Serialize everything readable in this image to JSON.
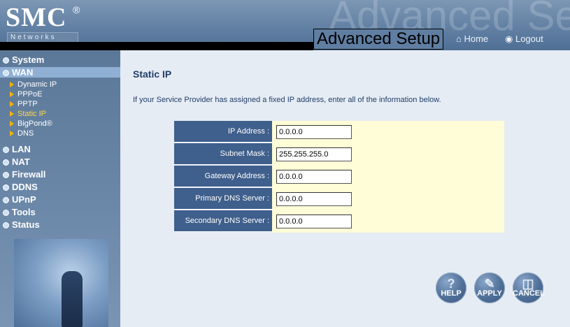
{
  "header": {
    "logo": "SMC",
    "logo_reg": "®",
    "networks": "Networks",
    "watermark": "Advanced Setup",
    "title": "Advanced Setup",
    "home": "Home",
    "logout": "Logout"
  },
  "sidebar": {
    "main": [
      {
        "label": "System"
      },
      {
        "label": "WAN",
        "active": true
      },
      {
        "label": "LAN"
      },
      {
        "label": "NAT"
      },
      {
        "label": "Firewall"
      },
      {
        "label": "DDNS"
      },
      {
        "label": "UPnP"
      },
      {
        "label": "Tools"
      },
      {
        "label": "Status"
      }
    ],
    "wan_sub": [
      {
        "label": "Dynamic IP"
      },
      {
        "label": "PPPoE"
      },
      {
        "label": "PPTP"
      },
      {
        "label": "Static IP",
        "selected": true
      },
      {
        "label": "BigPond®"
      },
      {
        "label": "DNS"
      }
    ]
  },
  "main": {
    "title": "Static IP",
    "intro": "If your Service Provider has assigned a fixed IP address, enter all of the information below.",
    "fields": [
      {
        "label": "IP Address :",
        "value": "0.0.0.0"
      },
      {
        "label": "Subnet Mask :",
        "value": "255.255.255.0"
      },
      {
        "label": "Gateway Address :",
        "value": "0.0.0.0"
      },
      {
        "label": "Primary DNS Server :",
        "value": "0.0.0.0"
      },
      {
        "label": "Secondary DNS Server :",
        "value": "0.0.0.0"
      }
    ],
    "buttons": {
      "help": "HELP",
      "apply": "APPLY",
      "cancel": "CANCEL"
    }
  },
  "colors": {
    "header_bg": "#5f7ea2",
    "sidebar_bg": "#6a86a7",
    "label_bg": "#3f5f8c",
    "value_bg": "#fffcd8",
    "main_bg": "#e6ecf4",
    "title_text": "#1f3d69",
    "selected_sub": "#ffd84a"
  }
}
